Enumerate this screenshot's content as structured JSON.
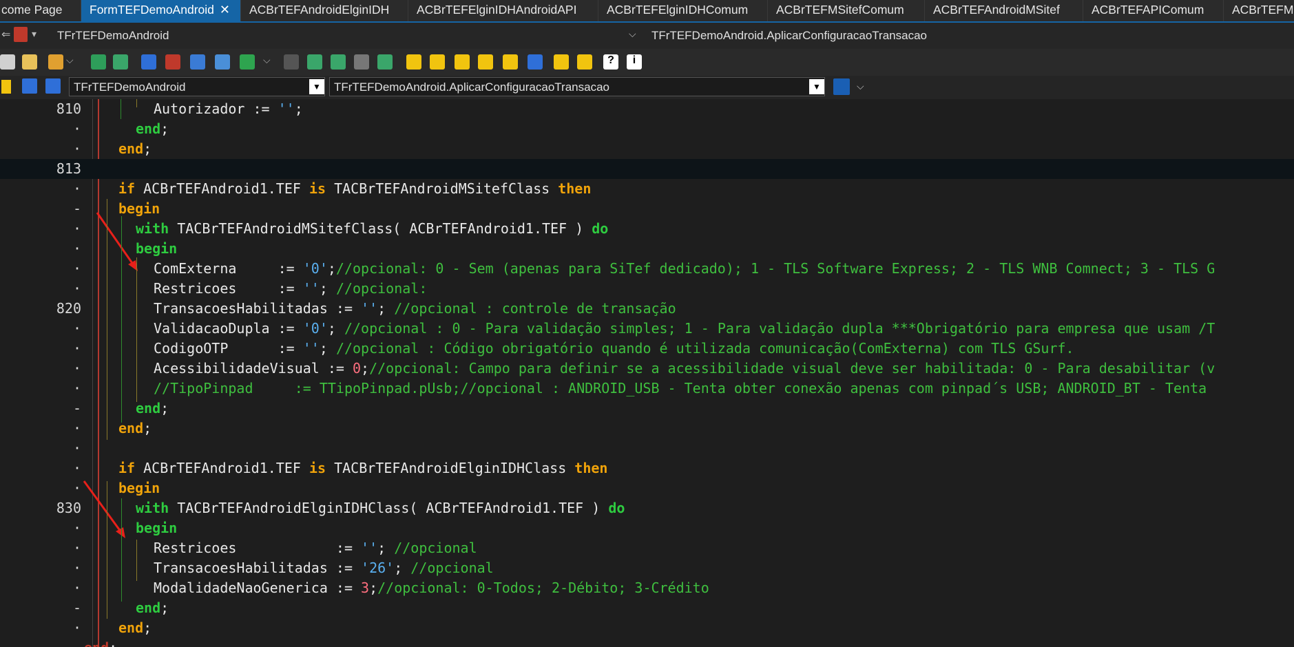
{
  "tabs": [
    {
      "label": "come Page"
    },
    {
      "label": "FormTEFDemoAndroid",
      "active": true
    },
    {
      "label": "ACBrTEFAndroidElginIDH"
    },
    {
      "label": "ACBrTEFElginIDHAndroidAPI"
    },
    {
      "label": "ACBrTEFElginIDHComum"
    },
    {
      "label": "ACBrTEFMSitefComum"
    },
    {
      "label": "ACBrTEFAndroidMSitef"
    },
    {
      "label": "ACBrTEFAPIComum"
    },
    {
      "label": "ACBrTEFM"
    }
  ],
  "nav": {
    "class_name": "TFrTEFDemoAndroid",
    "method_name": "TFrTEFDemoAndroid.AplicarConfiguracaoTransacao"
  },
  "combos": {
    "class_value": "TFrTEFDemoAndroid",
    "method_value": "TFrTEFDemoAndroid.AplicarConfiguracaoTransacao"
  },
  "lines": [
    {
      "num": "810",
      "indent": 3,
      "tokens": [
        [
          "",
          "Autorizador := "
        ],
        [
          "str",
          "''"
        ],
        [
          "",
          ";"
        ]
      ]
    },
    {
      "num": "·",
      "indent": 2,
      "tokens": [
        [
          "kw2",
          "end"
        ],
        [
          "",
          ";"
        ]
      ]
    },
    {
      "num": "·",
      "indent": 1,
      "tokens": [
        [
          "kw",
          "end"
        ],
        [
          "",
          ";"
        ]
      ]
    },
    {
      "num": "813",
      "indent": 0,
      "current": true,
      "tokens": []
    },
    {
      "num": "·",
      "indent": 1,
      "tokens": [
        [
          "kw",
          "if"
        ],
        [
          "",
          " ACBrTEFAndroid1.TEF "
        ],
        [
          "kw",
          "is"
        ],
        [
          "",
          " TACBrTEFAndroidMSitefClass "
        ],
        [
          "kw",
          "then"
        ]
      ]
    },
    {
      "num": "-",
      "indent": 1,
      "tokens": [
        [
          "kw",
          "begin"
        ]
      ]
    },
    {
      "num": "·",
      "indent": 2,
      "tokens": [
        [
          "kw2",
          "with"
        ],
        [
          "",
          " TACBrTEFAndroidMSitefClass( ACBrTEFAndroid1.TEF ) "
        ],
        [
          "kw2",
          "do"
        ]
      ]
    },
    {
      "num": "·",
      "indent": 2,
      "tokens": [
        [
          "kw2",
          "begin"
        ]
      ]
    },
    {
      "num": "·",
      "indent": 3,
      "tokens": [
        [
          "",
          "ComExterna     := "
        ],
        [
          "str",
          "'0'"
        ],
        [
          "",
          ";"
        ],
        [
          "cm",
          "//opcional: 0 - Sem (apenas para SiTef dedicado); 1 - TLS Software Express; 2 - TLS WNB Comnect; 3 - TLS G"
        ]
      ]
    },
    {
      "num": "·",
      "indent": 3,
      "tokens": [
        [
          "",
          "Restricoes     := "
        ],
        [
          "str",
          "''"
        ],
        [
          "",
          "; "
        ],
        [
          "cm",
          "//opcional:"
        ]
      ]
    },
    {
      "num": "820",
      "indent": 3,
      "tokens": [
        [
          "",
          "TransacoesHabilitadas := "
        ],
        [
          "str",
          "''"
        ],
        [
          "",
          "; "
        ],
        [
          "cm",
          "//opcional : controle de transação"
        ]
      ]
    },
    {
      "num": "·",
      "indent": 3,
      "tokens": [
        [
          "",
          "ValidacaoDupla := "
        ],
        [
          "str",
          "'0'"
        ],
        [
          "",
          "; "
        ],
        [
          "cm",
          "//opcional : 0 - Para validação simples; 1 - Para validação dupla ***Obrigatório para empresa que usam /T"
        ]
      ]
    },
    {
      "num": "·",
      "indent": 3,
      "tokens": [
        [
          "",
          "CodigoOTP      := "
        ],
        [
          "str",
          "''"
        ],
        [
          "",
          "; "
        ],
        [
          "cm",
          "//opcional : Código obrigatório quando é utilizada comunicação(ComExterna) com TLS GSurf."
        ]
      ]
    },
    {
      "num": "·",
      "indent": 3,
      "tokens": [
        [
          "",
          "AcessibilidadeVisual := "
        ],
        [
          "num",
          "0"
        ],
        [
          "",
          ";"
        ],
        [
          "cm",
          "//opcional: Campo para definir se a acessibilidade visual deve ser habilitada: 0 - Para desabilitar (v"
        ]
      ]
    },
    {
      "num": "·",
      "indent": 3,
      "tokens": [
        [
          "cm",
          "//TipoPinpad     := TTipoPinpad.pUsb;//opcional : ANDROID_USB - Tenta obter conexão apenas com pinpad´s USB; ANDROID_BT - Tenta"
        ]
      ]
    },
    {
      "num": "-",
      "indent": 2,
      "tokens": [
        [
          "kw2",
          "end"
        ],
        [
          "",
          ";"
        ]
      ]
    },
    {
      "num": "·",
      "indent": 1,
      "tokens": [
        [
          "kw",
          "end"
        ],
        [
          "",
          ";"
        ]
      ]
    },
    {
      "num": "·",
      "indent": 0,
      "tokens": []
    },
    {
      "num": "·",
      "indent": 1,
      "tokens": [
        [
          "kw",
          "if"
        ],
        [
          "",
          " ACBrTEFAndroid1.TEF "
        ],
        [
          "kw",
          "is"
        ],
        [
          "",
          " TACBrTEFAndroidElginIDHClass "
        ],
        [
          "kw",
          "then"
        ]
      ]
    },
    {
      "num": "·",
      "indent": 1,
      "tokens": [
        [
          "kw",
          "begin"
        ]
      ]
    },
    {
      "num": "830",
      "indent": 2,
      "tokens": [
        [
          "kw2",
          "with"
        ],
        [
          "",
          " TACBrTEFAndroidElginIDHClass( ACBrTEFAndroid1.TEF ) "
        ],
        [
          "kw2",
          "do"
        ]
      ]
    },
    {
      "num": "·",
      "indent": 2,
      "tokens": [
        [
          "kw2",
          "begin"
        ]
      ]
    },
    {
      "num": "·",
      "indent": 3,
      "tokens": [
        [
          "",
          "Restricoes            := "
        ],
        [
          "str",
          "''"
        ],
        [
          "",
          "; "
        ],
        [
          "cm",
          "//opcional"
        ]
      ]
    },
    {
      "num": "·",
      "indent": 3,
      "tokens": [
        [
          "",
          "TransacoesHabilitadas := "
        ],
        [
          "str",
          "'26'"
        ],
        [
          "",
          "; "
        ],
        [
          "cm",
          "//opcional"
        ]
      ]
    },
    {
      "num": "·",
      "indent": 3,
      "tokens": [
        [
          "",
          "ModalidadeNaoGenerica := "
        ],
        [
          "num",
          "3"
        ],
        [
          "",
          ";"
        ],
        [
          "cm",
          "//opcional: 0-Todos; 2-Débito; 3-Crédito"
        ]
      ]
    },
    {
      "num": "-",
      "indent": 2,
      "tokens": [
        [
          "kw2",
          "end"
        ],
        [
          "",
          ";"
        ]
      ]
    },
    {
      "num": "·",
      "indent": 1,
      "tokens": [
        [
          "kw",
          "end"
        ],
        [
          "",
          ";"
        ]
      ]
    },
    {
      "num": "",
      "indent": 0,
      "tokens": [
        [
          "kw",
          "end"
        ],
        [
          "",
          ";"
        ]
      ]
    }
  ],
  "colors": {
    "accent_tab": "#1565a6",
    "keyword": "#f0a30a",
    "keyword_block": "#2ecc40",
    "string": "#5ab0f0",
    "number": "#ff6f7f",
    "comment": "#3fbf3f",
    "annotation_arrow": "#e8201a"
  }
}
